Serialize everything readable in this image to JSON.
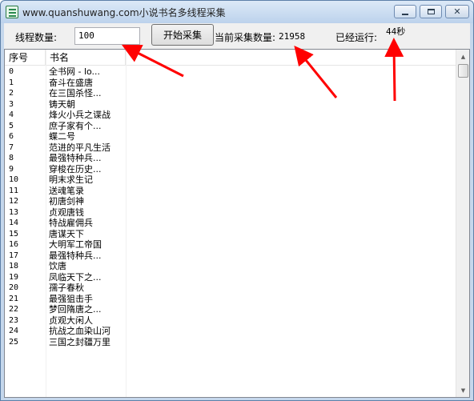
{
  "window": {
    "title": "www.quanshuwang.com小说书名多线程采集",
    "controls": {
      "minimize": "minimize",
      "maximize": "maximize",
      "close": "✕"
    }
  },
  "toolbar": {
    "thread_label": "线程数量:",
    "thread_value": "100",
    "start_button": "开始采集",
    "collected_label": "当前采集数量:",
    "collected_value": "21958",
    "runtime_label": "已经运行:",
    "runtime_value": "44秒"
  },
  "table": {
    "columns": [
      "序号",
      "书名"
    ],
    "rows": [
      [
        "0",
        "全书网 - lo..."
      ],
      [
        "1",
        "奋斗在盛唐"
      ],
      [
        "2",
        "在三国杀怪..."
      ],
      [
        "3",
        "铸天朝"
      ],
      [
        "4",
        "烽火小兵之谍战"
      ],
      [
        "5",
        "庶子家有个..."
      ],
      [
        "6",
        "蝶二号"
      ],
      [
        "7",
        "范进的平凡生活"
      ],
      [
        "8",
        "最强特种兵..."
      ],
      [
        "9",
        "穿梭在历史..."
      ],
      [
        "10",
        "明末求生记"
      ],
      [
        "11",
        "送魂笔录"
      ],
      [
        "12",
        "初唐剑神"
      ],
      [
        "13",
        "贞观唐钱"
      ],
      [
        "14",
        "特战雇佣兵"
      ],
      [
        "15",
        "唐谋天下"
      ],
      [
        "16",
        "大明军工帝国"
      ],
      [
        "17",
        "最强特种兵..."
      ],
      [
        "18",
        "饮唐"
      ],
      [
        "19",
        "凤临天下之..."
      ],
      [
        "20",
        "孺子春秋"
      ],
      [
        "21",
        "最强狙击手"
      ],
      [
        "22",
        "梦回隋唐之..."
      ],
      [
        "23",
        "贞观大闲人"
      ],
      [
        "24",
        "抗战之血染山河"
      ],
      [
        "25",
        "三国之封疆万里"
      ]
    ]
  },
  "annotation_color": "#ff0000"
}
